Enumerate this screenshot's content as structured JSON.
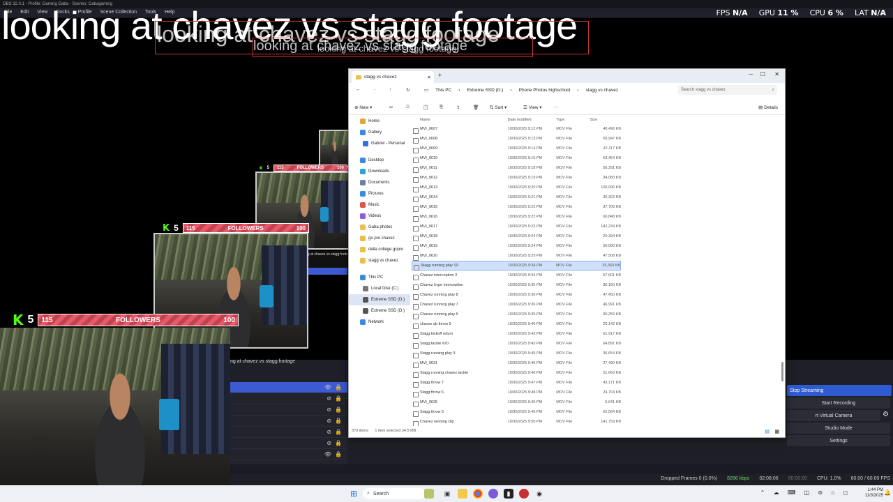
{
  "obs": {
    "titlebar": "OBS 32.0.1 - Profile: Gaming Gaba - Scenes: Gabagaming",
    "menu": [
      "File",
      "Edit",
      "View",
      "Docks",
      "Profile",
      "Scene Collection",
      "Tools",
      "Help"
    ],
    "stats": {
      "fps_label": "FPS",
      "fps_value": "N/A",
      "gpu_label": "GPU",
      "gpu_value": "11 %",
      "cpu_label": "CPU",
      "cpu_value": "6 %",
      "lat_label": "LAT",
      "lat_value": "N/A"
    },
    "stream_title": "looking at chavez vs stagg footage",
    "scene_text": "ng at chavez vs stagg footage",
    "followers": {
      "platform_count": "5",
      "current": "115",
      "label": "FOLLOWERS",
      "goal": "100"
    },
    "controls": [
      "Stop Streaming",
      "Start Recording",
      "rt Virtual Camera",
      "Studio Mode",
      "Settings"
    ],
    "status": {
      "dropped_frames": "Dropped Frames 0 (0.0%)",
      "bitrate": "8286 kbps",
      "stream_time": "02:08:06",
      "rec_time": "00:00:00",
      "cpu": "CPU: 1.0%",
      "fps": "60.00 / 60.00 FPS"
    }
  },
  "explorer": {
    "tab_title": "stagg vs chavez",
    "breadcrumb": [
      "This PC",
      "Extreme SSD (D:)",
      "Phone Photos highschool",
      "stagg vs chavez"
    ],
    "search_placeholder": "Search stagg vs chavez",
    "toolbar": {
      "new": "New",
      "sort": "Sort",
      "view": "View",
      "details": "Details"
    },
    "nav": [
      {
        "label": "Home",
        "color": "#e0a63a"
      },
      {
        "label": "Gallery",
        "color": "#3a8be0"
      },
      {
        "label": "Gabriel - Personal",
        "color": "#2f74d0"
      },
      {
        "label": "Desktop",
        "color": "#3a8be0"
      },
      {
        "label": "Downloads",
        "color": "#2aa3d8"
      },
      {
        "label": "Documents",
        "color": "#6b7fa6"
      },
      {
        "label": "Pictures",
        "color": "#3a8be0"
      },
      {
        "label": "Music",
        "color": "#e2534a"
      },
      {
        "label": "Videos",
        "color": "#8a5ad8"
      },
      {
        "label": "Gaba photos",
        "color": "#e8c04a"
      },
      {
        "label": "go pro chavez",
        "color": "#e8c04a"
      },
      {
        "label": "della college gopro",
        "color": "#e8c04a"
      },
      {
        "label": "stagg vs chavez",
        "color": "#e8c04a"
      },
      {
        "label": "This PC",
        "color": "#3a8be0"
      },
      {
        "label": "Local Disk (C:)",
        "color": "#777777"
      },
      {
        "label": "Extreme SSD (D:)",
        "color": "#555555"
      },
      {
        "label": "Extreme SSD (D:)",
        "color": "#555555"
      },
      {
        "label": "Network",
        "color": "#3a8be0"
      }
    ],
    "columns": [
      "Name",
      "Date modified",
      "Type",
      "Size"
    ],
    "files": [
      {
        "name": "MVI_0607",
        "date": "10/30/2025 9:12 PM",
        "type": "MOV File",
        "size": "40,496 KB"
      },
      {
        "name": "MVI_0608",
        "date": "10/30/2025 9:13 PM",
        "type": "MOV File",
        "size": "55,947 KB"
      },
      {
        "name": "MVI_0609",
        "date": "10/30/2025 9:14 PM",
        "type": "MOV File",
        "size": "47,117 KB"
      },
      {
        "name": "MVI_0610",
        "date": "10/30/2025 9:15 PM",
        "type": "MOV File",
        "size": "53,454 KB"
      },
      {
        "name": "MVI_0611",
        "date": "10/30/2025 9:18 PM",
        "type": "MOV File",
        "size": "56,291 KB"
      },
      {
        "name": "MVI_0612",
        "date": "10/30/2025 9:19 PM",
        "type": "MOV File",
        "size": "34,083 KB"
      },
      {
        "name": "MVI_0613",
        "date": "10/30/2025 9:20 PM",
        "type": "MOV File",
        "size": "100,096 KB"
      },
      {
        "name": "MVI_0614",
        "date": "10/30/2025 9:21 PM",
        "type": "MOV File",
        "size": "30,302 KB"
      },
      {
        "name": "MVI_0615",
        "date": "10/30/2025 9:22 PM",
        "type": "MOV File",
        "size": "37,700 KB"
      },
      {
        "name": "MVI_0616",
        "date": "10/30/2025 9:22 PM",
        "type": "MOV File",
        "size": "60,848 KB"
      },
      {
        "name": "MVI_0617",
        "date": "10/30/2025 9:23 PM",
        "type": "MOV File",
        "size": "142,234 KB"
      },
      {
        "name": "MVI_0618",
        "date": "10/30/2025 9:24 PM",
        "type": "MOV File",
        "size": "20,394 KB"
      },
      {
        "name": "MVI_0619",
        "date": "10/30/2025 9:24 PM",
        "type": "MOV File",
        "size": "50,090 KB"
      },
      {
        "name": "MVI_0620",
        "date": "10/30/2025 9:29 PM",
        "type": "MOV File",
        "size": "47,508 KB"
      },
      {
        "name": "Stagg running play 10",
        "date": "10/30/2025 9:34 PM",
        "type": "MOV File",
        "size": "35,360 KB",
        "selected": true
      },
      {
        "name": "Chavez interception 3",
        "date": "10/30/2025 9:34 PM",
        "type": "MOV File",
        "size": "57,601 KB"
      },
      {
        "name": "Chavez hype interception",
        "date": "10/30/2025 9:35 PM",
        "type": "MOV File",
        "size": "80,150 KB"
      },
      {
        "name": "Chavez running play 8",
        "date": "10/30/2025 9:36 PM",
        "type": "MOV File",
        "size": "47,450 KB"
      },
      {
        "name": "Chavez running play 7",
        "date": "10/30/2025 9:36 PM",
        "type": "MOV File",
        "size": "46,991 KB"
      },
      {
        "name": "Chavez running play 6",
        "date": "10/30/2025 9:39 PM",
        "type": "MOV File",
        "size": "90,259 KB"
      },
      {
        "name": "chavez qb throw 5",
        "date": "10/30/2025 9:40 PM",
        "type": "MOV File",
        "size": "20,142 KB"
      },
      {
        "name": "Stagg kickoff return",
        "date": "10/30/2025 9:42 PM",
        "type": "MOV File",
        "size": "61,917 KB"
      },
      {
        "name": "Stagg tackle #20",
        "date": "10/30/2025 9:43 PM",
        "type": "MOV File",
        "size": "64,891 KB"
      },
      {
        "name": "Stagg running play 9",
        "date": "10/30/2025 9:45 PM",
        "type": "MOV File",
        "size": "36,654 KB"
      },
      {
        "name": "MVI_0631",
        "date": "10/30/2025 9:46 PM",
        "type": "MOV File",
        "size": "27,490 KB"
      },
      {
        "name": "Stagg running chavez tackle",
        "date": "10/30/2025 9:46 PM",
        "type": "MOV File",
        "size": "51,669 KB"
      },
      {
        "name": "Stagg throw 7",
        "date": "10/30/2025 9:47 PM",
        "type": "MOV File",
        "size": "43,171 KB"
      },
      {
        "name": "Stagg throw 6",
        "date": "10/30/2025 9:48 PM",
        "type": "MOV File",
        "size": "24,704 KB"
      },
      {
        "name": "MVI_0635",
        "date": "10/30/2025 9:49 PM",
        "type": "MOV File",
        "size": "5,641 KB"
      },
      {
        "name": "Stagg throw 5",
        "date": "10/30/2025 9:49 PM",
        "type": "MOV File",
        "size": "62,564 KB"
      },
      {
        "name": "Chavez winning clip",
        "date": "10/30/2025 9:50 PM",
        "type": "MOV File",
        "size": "141,759 KB"
      }
    ],
    "status": {
      "items": "379 items",
      "selected": "1 item selected  34.5 MB"
    }
  },
  "taskbar": {
    "search_label": "Search",
    "time": "1:44 PM",
    "date": "11/3/2025"
  }
}
